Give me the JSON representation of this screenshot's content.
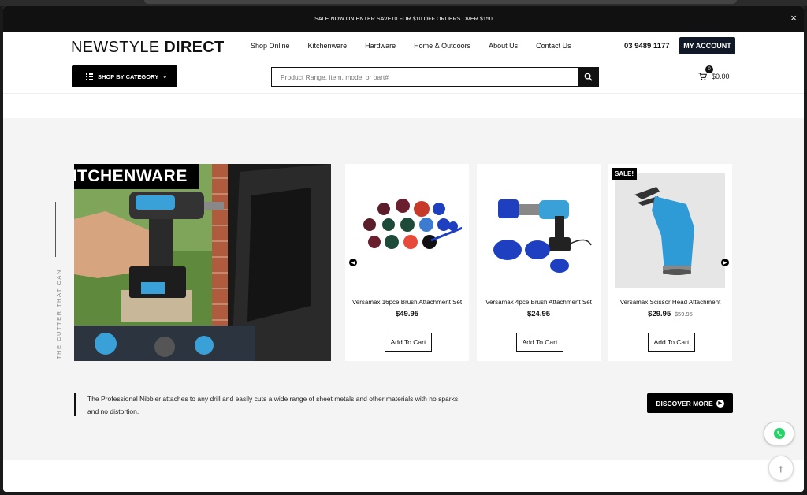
{
  "announcement": {
    "text": "SALE NOW ON ENTER SAVE10 FOR $10 OFF ORDERS OVER $150",
    "close": "×"
  },
  "header": {
    "logo_light": "NEWSTYLE",
    "logo_bold": "DIRECT",
    "nav": [
      "Shop Online",
      "Kitchenware",
      "Hardware",
      "Home & Outdoors",
      "About Us",
      "Contact Us"
    ],
    "phone": "03 9489 1177",
    "account": "MY ACCOUNT",
    "shop_by_category": "SHOP BY CATEGORY",
    "search_placeholder": "Product Range, item, model or part#",
    "cart_count": "0",
    "cart_total": "$0.00"
  },
  "feature": {
    "title": "KITCHENWARE",
    "vertical_text": "THE CUTTER THAT CAN",
    "description_line1": "The Professional Nibbler attaches to any drill and easily cuts a wide range of sheet metals and other materials with no sparks",
    "description_line2": "and no distortion.",
    "cta": "DISCOVER MORE"
  },
  "products": [
    {
      "name": "Versamax 16pce Brush Attachment Set",
      "price": "$49.95",
      "button": "Add To Cart"
    },
    {
      "name": "Versamax 4pce Brush Attachment Set",
      "price": "$24.95",
      "button": "Add To Cart"
    },
    {
      "name": "Versamax Scissor Head Attachment",
      "price": "$29.95",
      "old_price": "$59.95",
      "button": "Add To Cart",
      "badge": "SALE!"
    }
  ],
  "colors": {
    "dark": "#111111",
    "section_bg": "#f4f4f4",
    "brush_blue": "#1e3fbf",
    "tool_blue": "#3aa0d8",
    "whatsapp": "#25d366"
  },
  "icons": [
    "close-icon",
    "grid-icon",
    "chevron-down-icon",
    "search-icon",
    "cart-icon",
    "arrow-left-icon",
    "arrow-right-icon",
    "arrow-circle-right-icon",
    "whatsapp-icon",
    "arrow-up-icon"
  ]
}
